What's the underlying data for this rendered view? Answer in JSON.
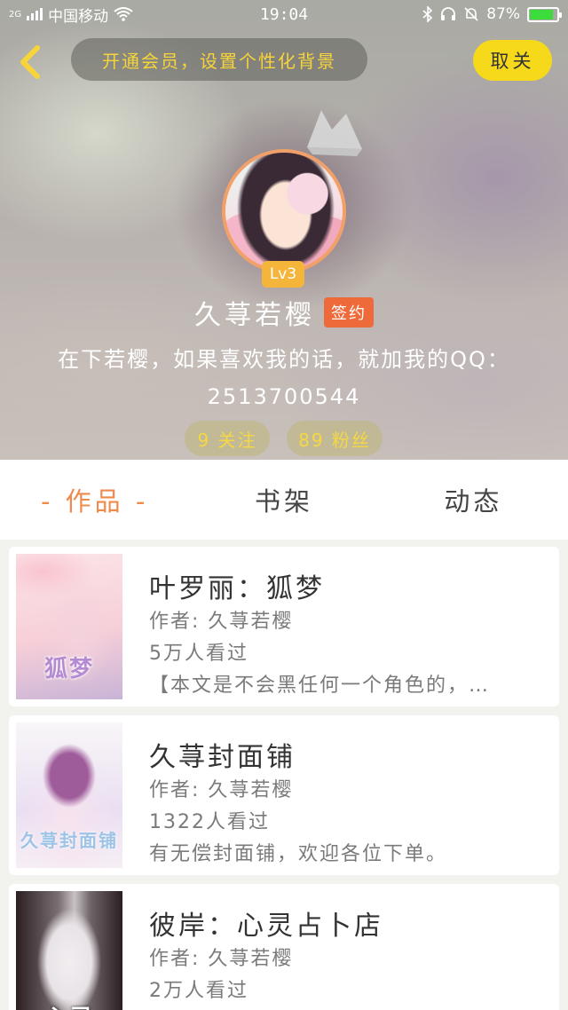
{
  "status_bar": {
    "network_type": "2G",
    "carrier": "中国移动",
    "time": "19:04",
    "battery": "87%",
    "icons": [
      "signal-icon",
      "wifi-icon",
      "bluetooth-icon",
      "headset-icon",
      "mute-icon",
      "battery-icon"
    ]
  },
  "header": {
    "vip_banner": "开通会员，设置个性化背景",
    "unfollow_label": "取关"
  },
  "profile": {
    "level": "Lv3",
    "name": "久荨若樱",
    "badge": "签约",
    "bio_line1": "在下若樱，如果喜欢我的话，就加我的QQ：",
    "bio_line2": "2513700544",
    "follow_count": "9 关注",
    "fans_count": "89 粉丝"
  },
  "tabs": [
    {
      "label": "- 作品 -",
      "active": true
    },
    {
      "label": "书架",
      "active": false
    },
    {
      "label": "动态",
      "active": false
    }
  ],
  "books": [
    {
      "title": "叶罗丽：狐梦",
      "author": "作者: 久荨若樱",
      "views": "5万人看过",
      "desc": "【本文是不会黑任何一个角色的，…",
      "cover_text": "狐梦"
    },
    {
      "title": "久荨封面铺",
      "author": "作者: 久荨若樱",
      "views": "1322人看过",
      "desc": "有无偿封面铺，欢迎各位下单。",
      "cover_text": "久荨封面铺"
    },
    {
      "title": "彼岸：心灵占卜店",
      "author": "作者: 久荨若樱",
      "views": "2万人看过",
      "desc": "",
      "cover_text": "心灵"
    }
  ],
  "colors": {
    "accent_orange": "#f08a4b",
    "vip_yellow": "#f7d43a",
    "button_yellow": "#f7d91b",
    "sign_badge": "#ef6a3a",
    "level_badge": "#f4b53a"
  }
}
